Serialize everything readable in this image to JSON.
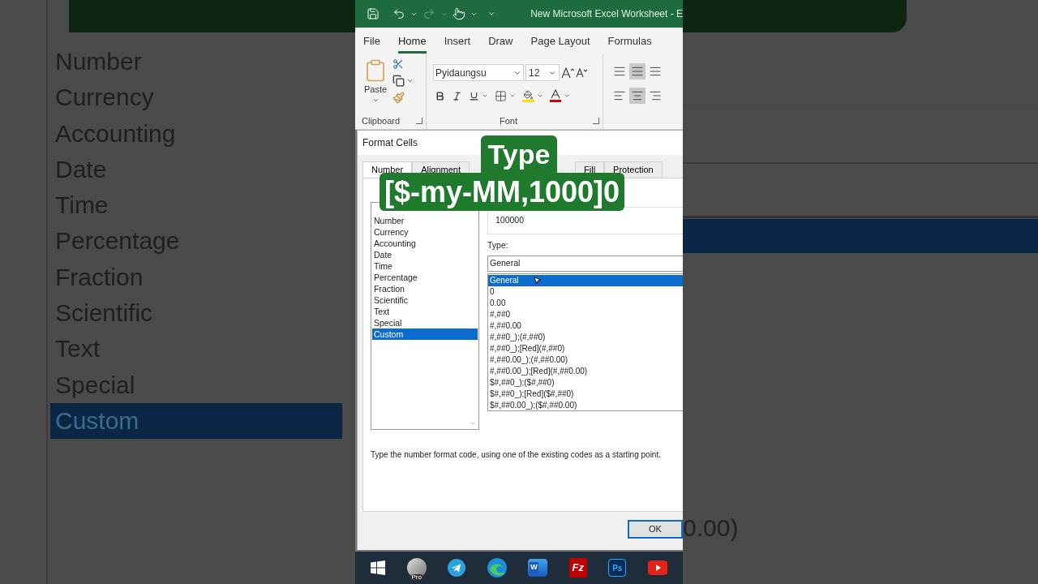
{
  "backdrop_left": {
    "categories": [
      {
        "label": "Number",
        "selected": false
      },
      {
        "label": "Currency",
        "selected": false
      },
      {
        "label": "Accounting",
        "selected": false
      },
      {
        "label": "Date",
        "selected": false
      },
      {
        "label": "Time",
        "selected": false
      },
      {
        "label": "Percentage",
        "selected": false
      },
      {
        "label": "Fraction",
        "selected": false
      },
      {
        "label": "Scientific",
        "selected": false
      },
      {
        "label": "Text",
        "selected": false
      },
      {
        "label": "Special",
        "selected": false
      },
      {
        "label": "Custom",
        "selected": true
      }
    ]
  },
  "backdrop_right": {
    "list_fragment": "0.00)"
  },
  "title_bar": {
    "title": "New Microsoft Excel Worksheet  -  E"
  },
  "ribbon_tabs": [
    {
      "label": "File",
      "selected": false
    },
    {
      "label": "Home",
      "selected": true
    },
    {
      "label": "Insert",
      "selected": false
    },
    {
      "label": "Draw",
      "selected": false
    },
    {
      "label": "Page Layout",
      "selected": false
    },
    {
      "label": "Formulas",
      "selected": false
    }
  ],
  "ribbon": {
    "paste_label": "Paste",
    "font_name": "Pyidaungsu",
    "font_size": "12",
    "groups": [
      "Clipboard",
      "Font"
    ]
  },
  "dialog": {
    "title": "Format Cells",
    "tabs": [
      {
        "label": "Number",
        "selected": true
      },
      {
        "label": "Alignment",
        "selected": false
      },
      {
        "label": "Fill",
        "selected": false
      },
      {
        "label": "Protection",
        "selected": false
      }
    ],
    "categories": [
      {
        "label": "Number",
        "selected": false
      },
      {
        "label": "Currency",
        "selected": false
      },
      {
        "label": "Accounting",
        "selected": false
      },
      {
        "label": "Date",
        "selected": false
      },
      {
        "label": "Time",
        "selected": false
      },
      {
        "label": "Percentage",
        "selected": false
      },
      {
        "label": "Fraction",
        "selected": false
      },
      {
        "label": "Scientific",
        "selected": false
      },
      {
        "label": "Text",
        "selected": false
      },
      {
        "label": "Special",
        "selected": false
      },
      {
        "label": "Custom",
        "selected": true
      }
    ],
    "sample": "100000",
    "type_label": "Type:",
    "type_value": "General",
    "formats": [
      {
        "label": "General",
        "selected": true
      },
      {
        "label": "0",
        "selected": false
      },
      {
        "label": "0.00",
        "selected": false
      },
      {
        "label": "#,##0",
        "selected": false
      },
      {
        "label": "#,##0.00",
        "selected": false
      },
      {
        "label": "#,##0_);(#,##0)",
        "selected": false
      },
      {
        "label": "#,##0_);[Red](#,##0)",
        "selected": false
      },
      {
        "label": "#,##0.00_);(#,##0.00)",
        "selected": false
      },
      {
        "label": "#,##0.00_);[Red](#,##0.00)",
        "selected": false
      },
      {
        "label": "$#,##0_);($#,##0)",
        "selected": false
      },
      {
        "label": "$#,##0_);[Red]($#,##0)",
        "selected": false
      },
      {
        "label": "$#,##0.00_);($#,##0.00)",
        "selected": false
      }
    ],
    "description": "Type the number format code, using one of the existing codes as a starting point.",
    "ok": "OK"
  },
  "caption": {
    "lines": [
      "Type",
      "[$-my-MM,1000]0"
    ]
  },
  "taskbar": {
    "apps": [
      {
        "kind": "windows"
      },
      {
        "kind": "globe",
        "badge": "Pro"
      },
      {
        "kind": "telegram"
      },
      {
        "kind": "edge"
      },
      {
        "kind": "word",
        "badge": "W"
      },
      {
        "kind": "filezilla",
        "badge": "Fz"
      },
      {
        "kind": "photoshop",
        "badge": "Ps"
      },
      {
        "kind": "youtube"
      }
    ]
  }
}
